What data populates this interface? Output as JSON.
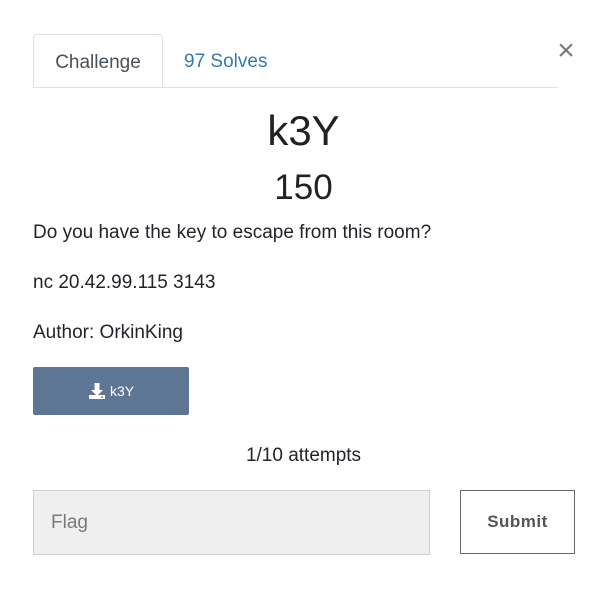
{
  "tabs": {
    "challenge_label": "Challenge",
    "solves_label": "97 Solves"
  },
  "close": {
    "symbol": "×"
  },
  "challenge": {
    "name": "k3Y",
    "value": "150",
    "description": "Do you have the key to escape from this room?",
    "connection": "nc 20.42.99.115 3143",
    "author": "Author: OrkinKing"
  },
  "download": {
    "label": "k3Y",
    "icon": "download-icon"
  },
  "attempts": "1/10 attempts",
  "flag": {
    "placeholder": "Flag",
    "value": ""
  },
  "submit_label": "Submit",
  "colors": {
    "accent_link": "#337ab7",
    "download_bg": "#5f7594",
    "input_bg": "#efefef"
  }
}
